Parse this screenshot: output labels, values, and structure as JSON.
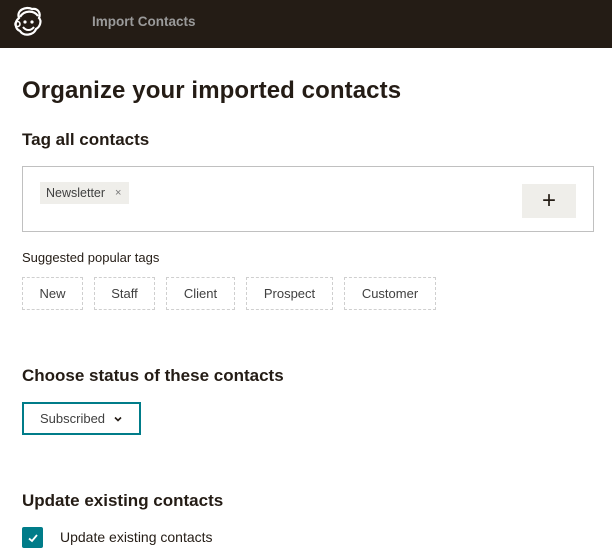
{
  "topbar": {
    "logo_icon": "mailchimp-freddie-logo",
    "title": "Import Contacts",
    "background": "#241c15"
  },
  "page": {
    "title": "Organize your imported contacts"
  },
  "tags": {
    "section_title": "Tag all contacts",
    "applied": [
      {
        "label": "Newsletter",
        "remove_icon": "×"
      }
    ],
    "add_button_icon": "+",
    "suggested_label": "Suggested popular tags",
    "suggested": [
      "New",
      "Staff",
      "Client",
      "Prospect",
      "Customer"
    ]
  },
  "status": {
    "section_title": "Choose status of these contacts",
    "selected": "Subscribed",
    "accent": "#007c89"
  },
  "update": {
    "section_title": "Update existing contacts",
    "checkbox_label": "Update existing contacts",
    "checked": true
  }
}
